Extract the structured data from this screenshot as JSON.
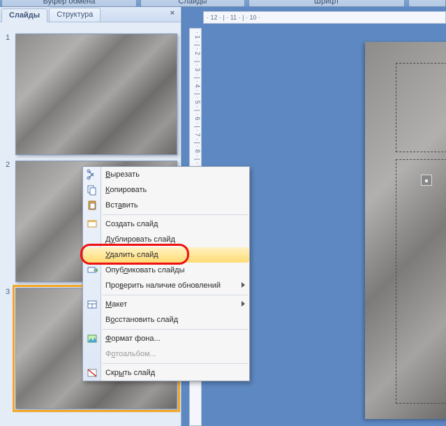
{
  "ribbon": {
    "clipboard": "Буфер обмена",
    "slides": "Слайды",
    "font": "Шрифт",
    "fourth": ""
  },
  "left": {
    "tab_slides": "Слайды",
    "tab_structure": "Структура",
    "close": "×",
    "thumbs": [
      {
        "num": "1",
        "title": ""
      },
      {
        "num": "2",
        "title": ""
      },
      {
        "num": "3",
        "title": ""
      }
    ]
  },
  "ruler": {
    "h": "· 12 · | · 11 · | · 10 ·",
    "v": "· 1 · | · 2 · | · 3 · | · 4 · | · 5 · | · 6 · | · 7 · | · 8 · | · 9 ·"
  },
  "ctx": {
    "cut": "Вырезать",
    "copy": "Копировать",
    "paste": "Вставить",
    "new_slide": "Создать слайд",
    "duplicate": "Дублировать слайд",
    "delete": "Удалить слайд",
    "publish": "Опубликовать слайды",
    "check_upd": "Проверить наличие обновлений",
    "layout": "Макет",
    "reset": "Восстановить слайд",
    "format_bg": "Формат фона...",
    "photoalbum": "Фотоальбом...",
    "hide": "Скрыть слайд"
  }
}
